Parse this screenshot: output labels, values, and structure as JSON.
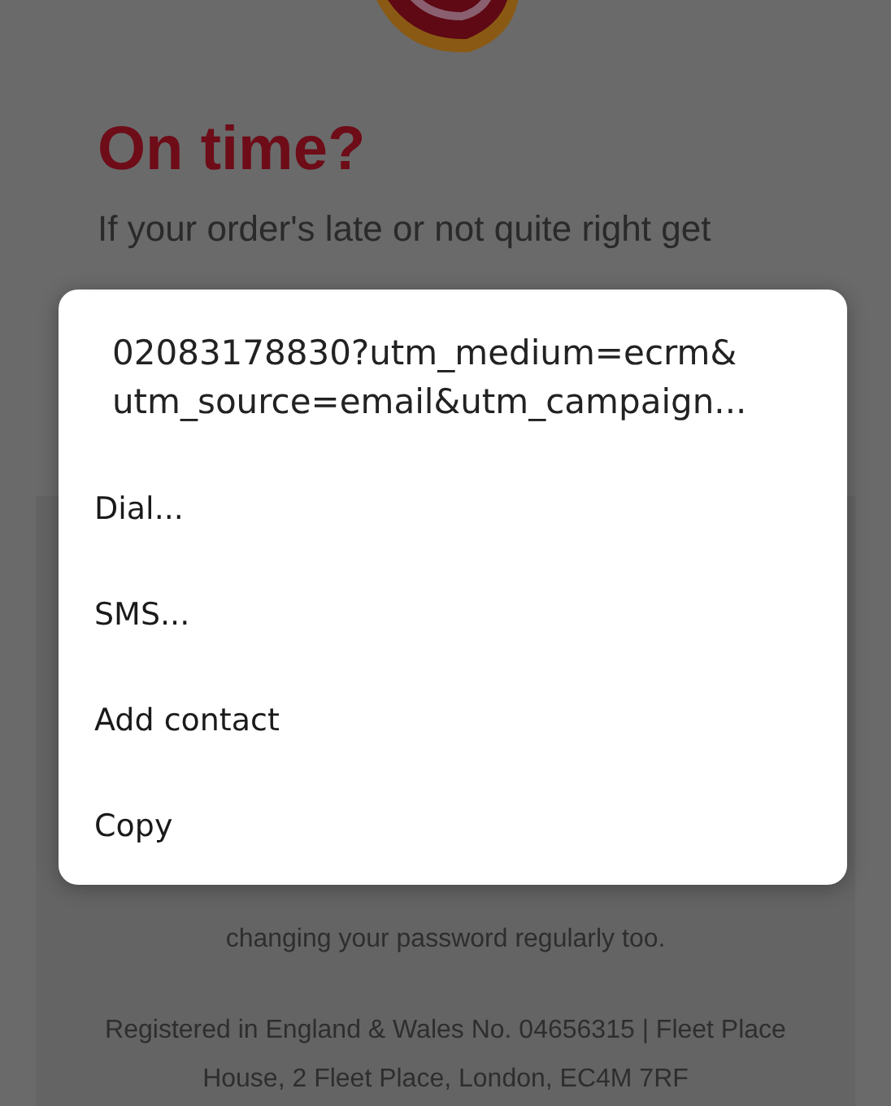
{
  "page": {
    "heading": "On time?",
    "intro": [
      "If your order's late or not quite right get"
    ],
    "notice": [
      "changing your password regularly too."
    ],
    "footer": "Registered in England & Wales No. 04656315 | Fleet Place House, 2 Fleet Place, London, EC4M 7RF"
  },
  "dialog": {
    "title": [
      "02083178830?utm_medium=ecrm&",
      "utm_source=email&utm_campaign..."
    ],
    "items": [
      {
        "label": "Dial..."
      },
      {
        "label": "SMS..."
      },
      {
        "label": "Add contact"
      },
      {
        "label": "Copy"
      }
    ]
  }
}
